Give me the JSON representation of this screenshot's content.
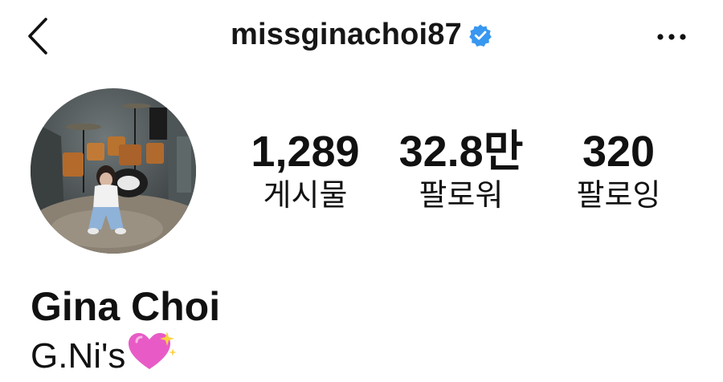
{
  "header": {
    "username": "missginachoi87",
    "verified": true,
    "back_icon": "chevron-left-icon",
    "more_icon": "more-horizontal-icon",
    "verified_color": "#3897f0"
  },
  "profile": {
    "avatar_icon": "profile-photo",
    "stats": [
      {
        "value": "1,289",
        "label": "게시물"
      },
      {
        "value": "32.8만",
        "label": "팔로워"
      },
      {
        "value": "320",
        "label": "팔로잉"
      }
    ],
    "display_name": "Gina Choi",
    "bio": "G.Ni's",
    "bio_emoji": "sparkling-heart-icon"
  }
}
